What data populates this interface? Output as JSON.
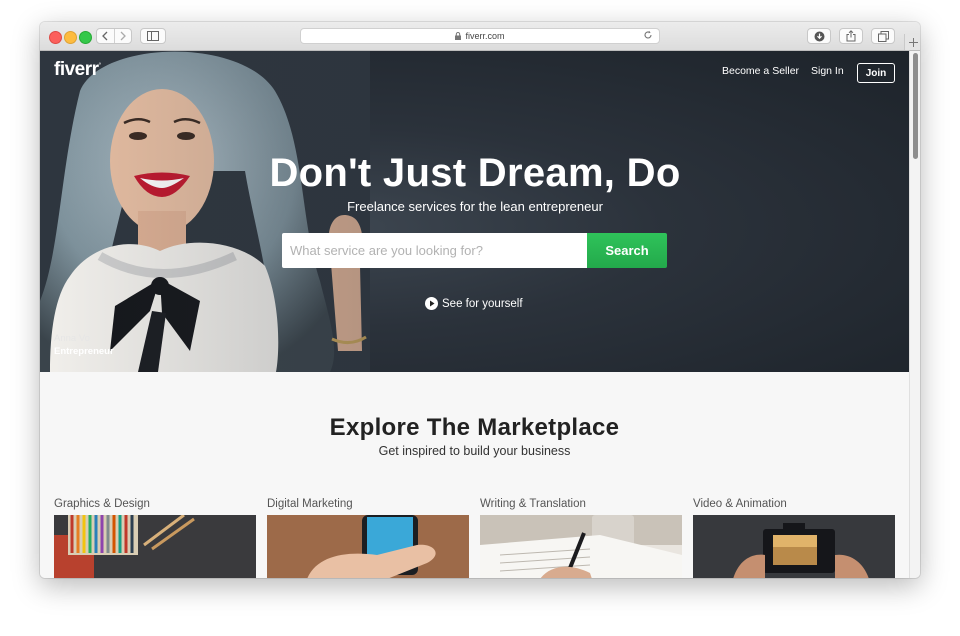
{
  "browser": {
    "url": "fiverr.com"
  },
  "header": {
    "logo": "fiverr",
    "logo_mark": "°",
    "become_seller": "Become a Seller",
    "sign_in": "Sign In",
    "join": "Join"
  },
  "hero": {
    "headline": "Don't Just Dream, Do",
    "subheadline": "Freelance services for the lean entrepreneur",
    "search_placeholder": "What service are you looking for?",
    "search_button": "Search",
    "video_link": "See for yourself",
    "caption_name": "Anna Vo",
    "caption_role": "Entrepreneur"
  },
  "marketplace": {
    "title": "Explore The Marketplace",
    "subtitle": "Get inspired to build your business",
    "categories": [
      {
        "label": "Graphics & Design"
      },
      {
        "label": "Digital Marketing"
      },
      {
        "label": "Writing & Translation"
      },
      {
        "label": "Video & Animation"
      }
    ]
  },
  "colors": {
    "search_green": "#1dbf73",
    "hero_bg": "#2b323b",
    "page_bg": "#f7f7f7"
  }
}
